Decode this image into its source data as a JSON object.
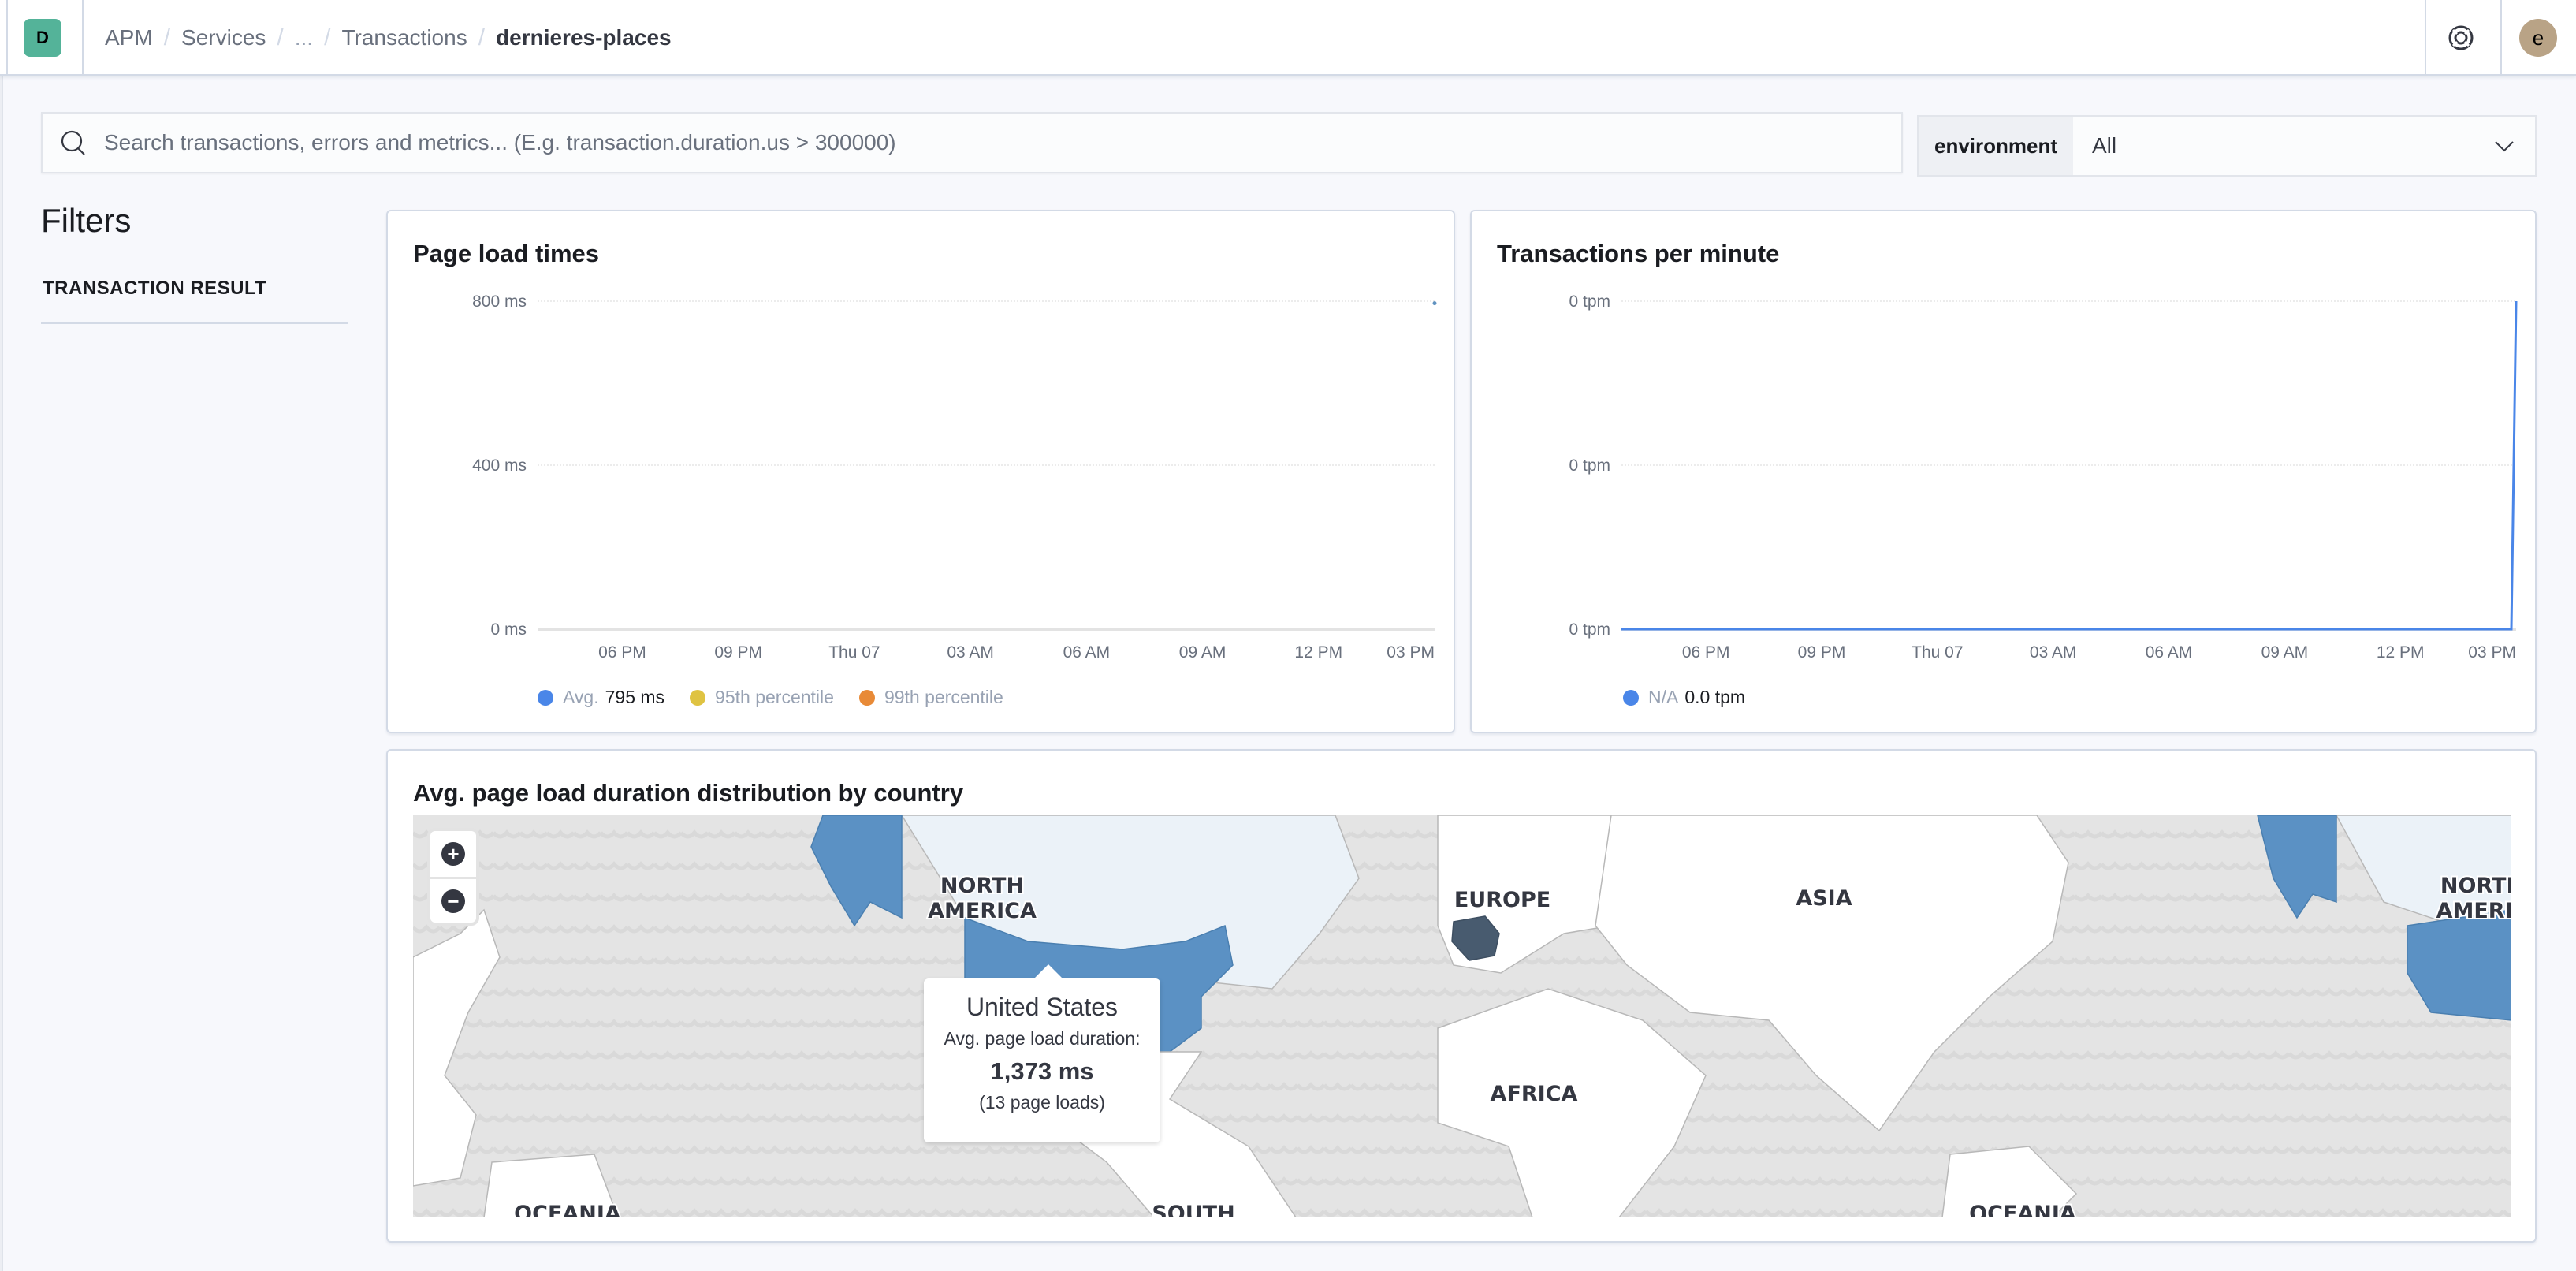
{
  "header": {
    "space_initial": "D",
    "breadcrumbs": [
      "APM",
      "Services",
      "...",
      "Transactions",
      "dernieres-places"
    ],
    "user_initial": "e",
    "help_icon": "help-lifebuoy-icon"
  },
  "search": {
    "placeholder": "Search transactions, errors and metrics... (E.g. transaction.duration.us > 300000)",
    "value": ""
  },
  "environment": {
    "label": "environment",
    "selected": "All"
  },
  "filters": {
    "title": "Filters",
    "sections": [
      "TRANSACTION RESULT"
    ]
  },
  "colors": {
    "accent_blue": "#5c93c6",
    "series_avg": "#6092c0",
    "series_95": "#d6bf57",
    "series_99": "#da8b45",
    "series_tpm": "#6092c0",
    "france_dark": "#485b6f"
  },
  "chart_data": [
    {
      "type": "line",
      "title": "Page load times",
      "xlabel": "",
      "ylabel": "",
      "x_ticks": [
        "06 PM",
        "09 PM",
        "Thu 07",
        "03 AM",
        "06 AM",
        "09 AM",
        "12 PM",
        "03 PM"
      ],
      "y_ticks": [
        "0 ms",
        "400 ms",
        "800 ms"
      ],
      "ylim": [
        0,
        800
      ],
      "grid": true,
      "legend_position": "bottom-left",
      "series": [
        {
          "name": "Avg.",
          "legend_value": "795 ms",
          "color": "#6092c0",
          "points": [
            {
              "x": "end",
              "y": 795
            }
          ]
        },
        {
          "name": "95th percentile",
          "legend_value": "",
          "color": "#d6bf57",
          "points": []
        },
        {
          "name": "99th percentile",
          "legend_value": "",
          "color": "#da8b45",
          "points": []
        }
      ]
    },
    {
      "type": "line",
      "title": "Transactions per minute",
      "xlabel": "",
      "ylabel": "",
      "x_ticks": [
        "06 PM",
        "09 PM",
        "Thu 07",
        "03 AM",
        "06 AM",
        "09 AM",
        "12 PM",
        "03 PM"
      ],
      "y_ticks": [
        "0 tpm",
        "0 tpm",
        "0 tpm"
      ],
      "ylim": [
        0,
        1
      ],
      "grid": true,
      "legend_position": "bottom-left",
      "series": [
        {
          "name": "N/A",
          "legend_value": "0.0 tpm",
          "color": "#6092c0",
          "values_fraction": [
            0,
            0,
            0,
            0,
            0,
            0,
            0,
            0,
            0,
            1
          ]
        }
      ]
    }
  ],
  "map": {
    "title": "Avg. page load duration distribution by country",
    "continent_labels": [
      "NORTH AMERICA",
      "EUROPE",
      "ASIA",
      "AFRICA",
      "OCEANIA",
      "SOUTH",
      "NORTH AMERIC",
      "OCEANIA"
    ],
    "highlighted_countries": [
      "United States",
      "France"
    ],
    "tooltip": {
      "country": "United States",
      "label": "Avg. page load duration:",
      "value": "1,373 ms",
      "count": "(13 page loads)"
    },
    "zoom_in": "+",
    "zoom_out": "−"
  }
}
